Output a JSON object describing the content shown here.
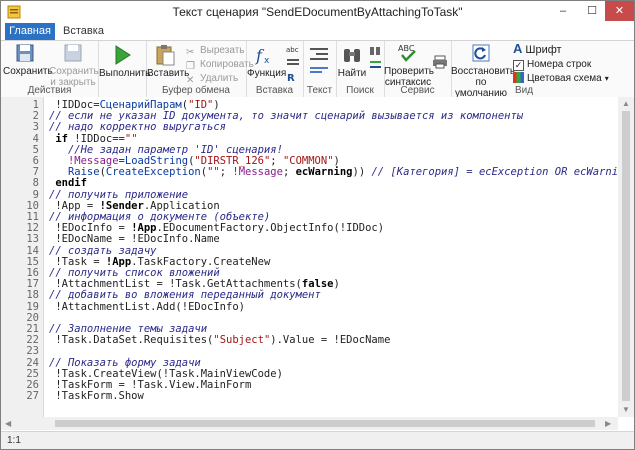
{
  "window": {
    "title": "Текст сценария \"SendEDocumentByAttachingToTask\"",
    "minimize": "–",
    "maximize": "☐",
    "close": "✕"
  },
  "tabs": [
    "Главная",
    "Вставка"
  ],
  "ribbon": {
    "actions": {
      "save": "Сохранить",
      "save_close_1": "Сохранить",
      "save_close_2": "и закрыть",
      "label": "Действия"
    },
    "run": {
      "run": "Выполнить"
    },
    "clipboard": {
      "paste": "Вставить",
      "cut": "Вырезать",
      "copy": "Копировать",
      "delete": "Удалить",
      "label": "Буфер обмена"
    },
    "insert": {
      "function": "Функция",
      "label": "Вставка"
    },
    "text": {
      "label": "Текст"
    },
    "search": {
      "find": "Найти",
      "label": "Поиск"
    },
    "service": {
      "check_1": "Проверить",
      "check_2": "синтаксис",
      "label": "Сервис"
    },
    "view": {
      "restore_1": "Восстановить",
      "restore_2": "по умолчанию",
      "font": "Шрифт",
      "line_numbers": "Номера строк",
      "color_scheme": "Цветовая схема",
      "label": "Вид"
    }
  },
  "code_lines": [
    {
      "n": "1",
      "t": " !IDDoc=СценарийПарам(\"ID\")"
    },
    {
      "n": "2",
      "t": "// если не указан ID документа, то значит сценарий вызывается из компоненты"
    },
    {
      "n": "3",
      "t": "// надо корректно выругаться"
    },
    {
      "n": "4",
      "t": " if !IDDoc==\"\""
    },
    {
      "n": "5",
      "t": "   //Не задан параметр 'ID' сценария!"
    },
    {
      "n": "6",
      "t": "   !Message=LoadString(\"DIRSTR_126\"; \"COMMON\")"
    },
    {
      "n": "7",
      "t": "   Raise(CreateException(\"\"; !Message; ecWarning)) // [Категория] = ecException OR ecWarning OR ecInformation"
    },
    {
      "n": "8",
      "t": " endif"
    },
    {
      "n": "9",
      "t": "// получить приложение"
    },
    {
      "n": "10",
      "t": " !App = !Sender.Application"
    },
    {
      "n": "11",
      "t": "// информация о документе (объекте)"
    },
    {
      "n": "12",
      "t": " !EDocInfo = !App.EDocumentFactory.ObjectInfo(!IDDoc)"
    },
    {
      "n": "13",
      "t": " !EDocName = !EDocInfo.Name"
    },
    {
      "n": "14",
      "t": "// создать задачу"
    },
    {
      "n": "15",
      "t": " !Task = !App.TaskFactory.CreateNew"
    },
    {
      "n": "16",
      "t": "// получить список вложений"
    },
    {
      "n": "17",
      "t": " !AttachmentList = !Task.GetAttachments(false)"
    },
    {
      "n": "18",
      "t": "// добавить во вложения переданный документ"
    },
    {
      "n": "19",
      "t": " !AttachmentList.Add(!EDocInfo)"
    },
    {
      "n": "20",
      "t": ""
    },
    {
      "n": "21",
      "t": "// Заполнение темы задачи"
    },
    {
      "n": "22",
      "t": " !Task.DataSet.Requisites(\"Subject\").Value = !EDocName"
    },
    {
      "n": "23",
      "t": ""
    },
    {
      "n": "24",
      "t": "// Показать форму задачи"
    },
    {
      "n": "25",
      "t": " !Task.CreateView(!Task.MainViewCode)"
    },
    {
      "n": "26",
      "t": " !TaskForm = !Task.View.MainForm"
    },
    {
      "n": "27",
      "t": " !TaskForm.Show"
    }
  ],
  "status": {
    "position": "1:1"
  }
}
